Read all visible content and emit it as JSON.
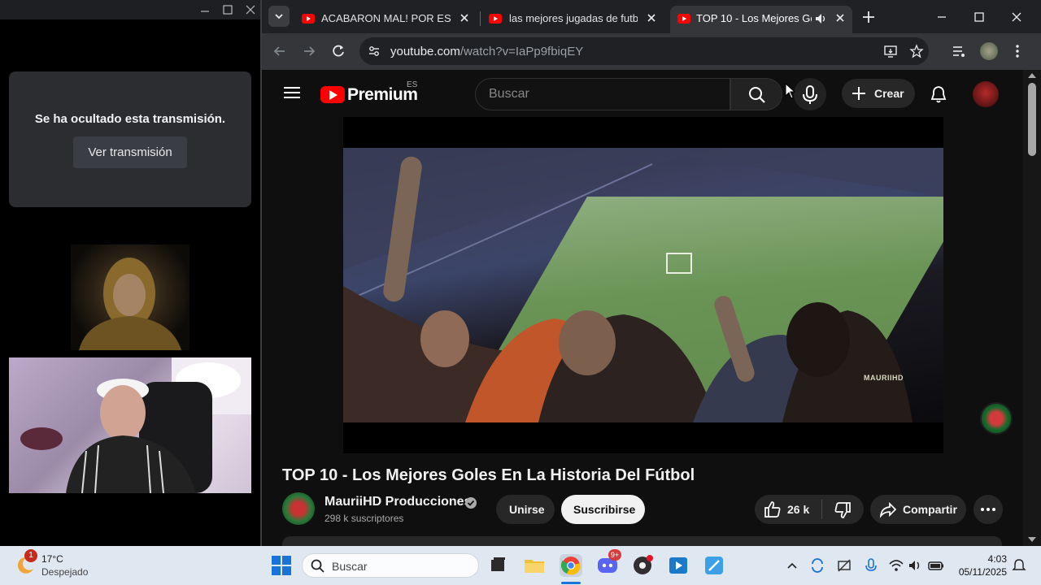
{
  "left_panel": {
    "hidden_message": "Se ha ocultado esta transmisión.",
    "view_button": "Ver transmisión"
  },
  "browser": {
    "tabs": [
      {
        "title": "ACABARON MAL! POR ESTE M",
        "active": false
      },
      {
        "title": "las mejores jugadas de futbol",
        "active": false
      },
      {
        "title": "TOP 10 - Los Mejores Gole",
        "active": true
      }
    ],
    "url_host": "youtube.com",
    "url_path": "/watch?v=IaPp9fbiqEY"
  },
  "youtube": {
    "logo_text": "Premium",
    "logo_region": "ES",
    "search_placeholder": "Buscar",
    "create_label": "Crear",
    "video_title": "TOP 10 - Los Mejores Goles En La Historia Del Fútbol",
    "channel_name": "MauriiHD Producciones",
    "subscribers": "298 k suscriptores",
    "join_label": "Unirse",
    "subscribe_label": "Suscribirse",
    "likes": "26 k",
    "share_label": "Compartir",
    "watermark": "MAURIIHD"
  },
  "taskbar": {
    "weather_temp": "17°C",
    "weather_desc": "Despejado",
    "weather_badge": "1",
    "search_placeholder": "Buscar",
    "discord_badge": "9+",
    "time": "4:03",
    "date": "05/11/2025"
  },
  "colors": {
    "yt_red": "#ff0000",
    "subscribe_bg": "#f1f1f1",
    "taskbar_bg": "#dfe7f1"
  }
}
